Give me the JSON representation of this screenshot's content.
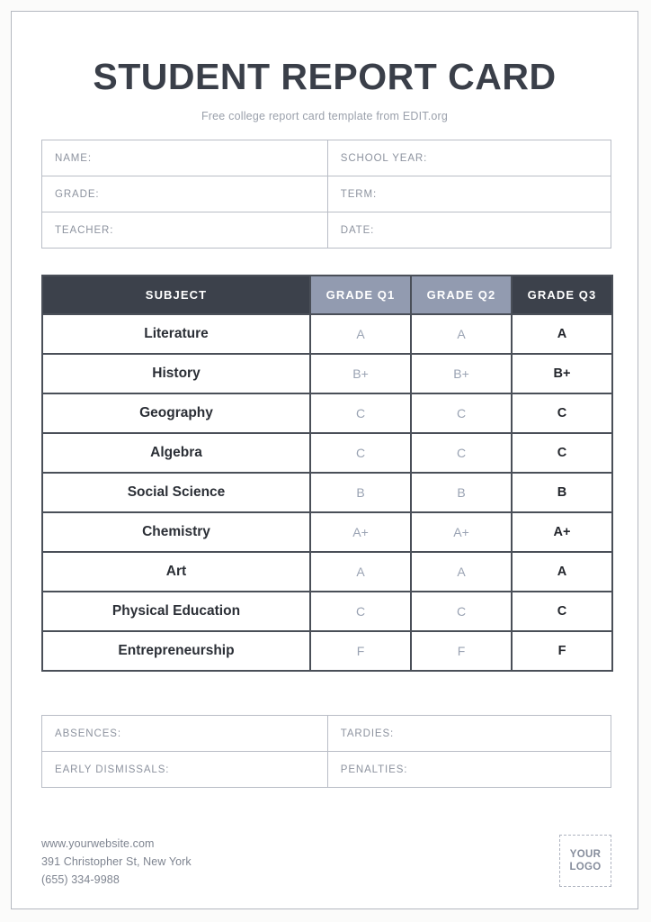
{
  "header": {
    "title": "STUDENT REPORT CARD",
    "subtitle": "Free college report card template from EDIT.org"
  },
  "info_fields": {
    "rows": [
      {
        "left": "NAME:",
        "right": "SCHOOL YEAR:"
      },
      {
        "left": "GRADE:",
        "right": "TERM:"
      },
      {
        "left": "TEACHER:",
        "right": "DATE:"
      }
    ]
  },
  "grades_table": {
    "columns": [
      "SUBJECT",
      "GRADE Q1",
      "GRADE Q2",
      "GRADE Q3"
    ],
    "rows": [
      {
        "subject": "Literature",
        "q1": "A",
        "q2": "A",
        "q3": "A"
      },
      {
        "subject": "History",
        "q1": "B+",
        "q2": "B+",
        "q3": "B+"
      },
      {
        "subject": "Geography",
        "q1": "C",
        "q2": "C",
        "q3": "C"
      },
      {
        "subject": "Algebra",
        "q1": "C",
        "q2": "C",
        "q3": "C"
      },
      {
        "subject": "Social Science",
        "q1": "B",
        "q2": "B",
        "q3": "B"
      },
      {
        "subject": "Chemistry",
        "q1": "A+",
        "q2": "A+",
        "q3": "A+"
      },
      {
        "subject": "Art",
        "q1": "A",
        "q2": "A",
        "q3": "A"
      },
      {
        "subject": "Physical Education",
        "q1": "C",
        "q2": "C",
        "q3": "C"
      },
      {
        "subject": "Entrepreneurship",
        "q1": "F",
        "q2": "F",
        "q3": "F"
      }
    ]
  },
  "attendance_fields": {
    "rows": [
      {
        "left": "ABSENCES:",
        "right": "TARDIES:"
      },
      {
        "left": "EARLY DISMISSALS:",
        "right": "PENALTIES:"
      }
    ]
  },
  "footer": {
    "website": "www.yourwebsite.com",
    "address": "391 Christopher St, New York",
    "phone": "(655) 334-9988",
    "logo_line1": "YOUR",
    "logo_line2": "LOGO"
  },
  "colors": {
    "header_dark": "#3c414b",
    "header_light": "#929bb0",
    "muted_text": "#9aa3b3",
    "border_light": "#b9bdc6",
    "border_table": "#4a4f58"
  }
}
